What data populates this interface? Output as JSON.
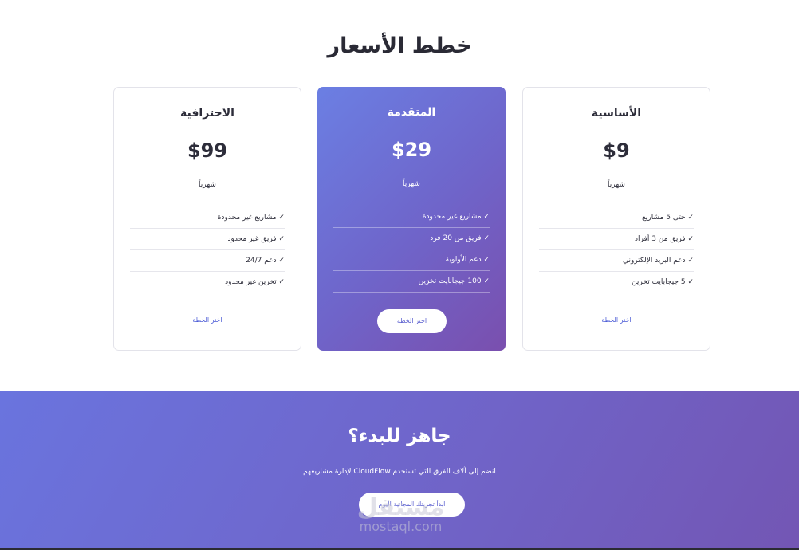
{
  "pricing": {
    "title": "خطط الأسعار",
    "plans": [
      {
        "name": "الأساسية",
        "price": "$9",
        "period": "شهرياً",
        "features": [
          "✓ حتى 5 مشاريع",
          "✓ فريق من 3 أفراد",
          "✓ دعم البريد الإلكتروني",
          "✓ 5 جيجابايت تخزين"
        ],
        "cta": "اختر الخطة"
      },
      {
        "name": "المتقدمة",
        "price": "$29",
        "period": "شهرياً",
        "features": [
          "✓ مشاريع غير محدودة",
          "✓ فريق من 20 فرد",
          "✓ دعم الأولوية",
          "✓ 100 جيجابايت تخزين"
        ],
        "cta": "اختر الخطة"
      },
      {
        "name": "الاحترافية",
        "price": "$99",
        "period": "شهرياً",
        "features": [
          "✓ مشاريع غير محدودة",
          "✓ فريق غير محدود",
          "✓ دعم 24/7",
          "✓ تخزين غير محدود"
        ],
        "cta": "اختر الخطة"
      }
    ]
  },
  "cta_section": {
    "title": "جاهز للبدء؟",
    "text": "انضم إلى آلاف الفرق التي تستخدم CloudFlow لإدارة مشاريعهم",
    "button": "ابدأ تجربتك المجانية اليوم"
  },
  "watermark": {
    "arabic": "مستقل",
    "latin": "mostaql.com"
  },
  "colors": {
    "accent": "#6b72dc",
    "accent_dark": "#7653b0",
    "text": "#2a2a35",
    "link": "#4b5bd6"
  }
}
